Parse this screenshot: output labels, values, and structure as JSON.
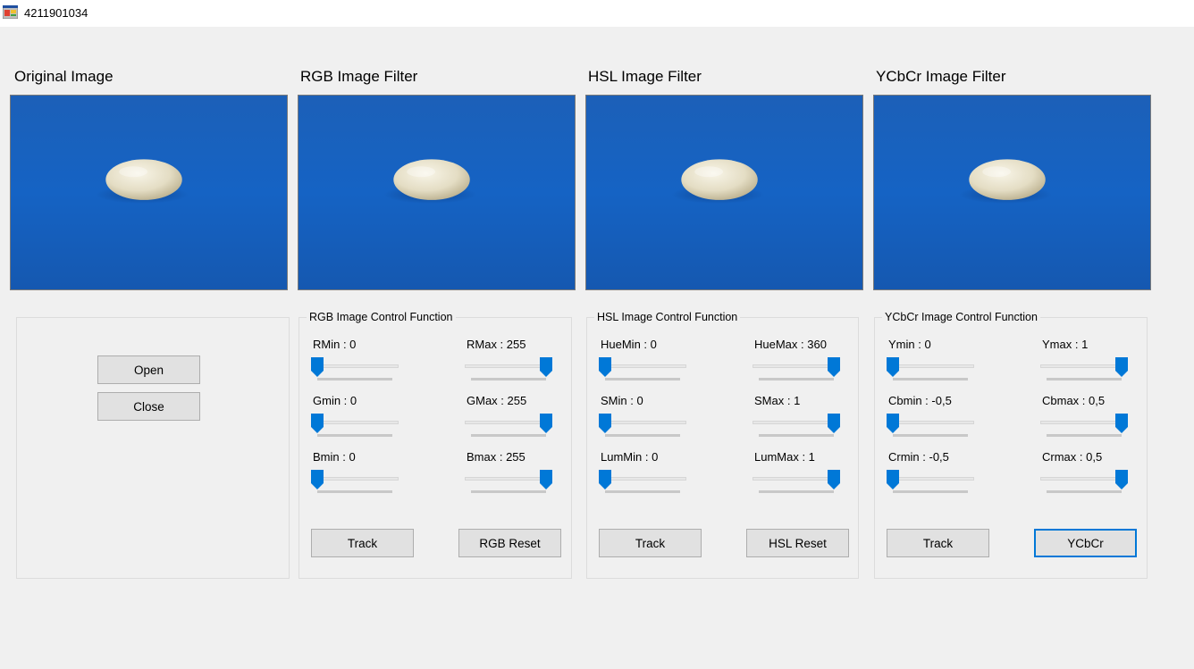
{
  "window": {
    "title": "4211901034"
  },
  "captions": [
    "Original Image",
    "RGB Image Filter",
    "HSL Image Filter",
    "YCbCr Image Filter"
  ],
  "image_icon": "pill-photo",
  "colors": {
    "accent": "#0078d7",
    "image_background": "#1a5fb4",
    "pill": "#e8e2cc"
  },
  "file_panel": {
    "open_label": "Open",
    "close_label": "Close"
  },
  "rgb": {
    "title": "RGB Image Control Function",
    "labels": [
      "RMin : 0",
      "RMax : 255",
      "Gmin : 0",
      "GMax : 255",
      "Bmin : 0",
      "Bmax : 255"
    ],
    "values": [
      0,
      1,
      0,
      1,
      0,
      1
    ],
    "track_label": "Track",
    "reset_label": "RGB Reset"
  },
  "hsl": {
    "title": "HSL Image Control Function",
    "labels": [
      "HueMin : 0",
      "HueMax : 360",
      "SMin : 0",
      "SMax : 1",
      "LumMin : 0",
      "LumMax : 1"
    ],
    "values": [
      0,
      1,
      0,
      1,
      0,
      1
    ],
    "track_label": "Track",
    "reset_label": "HSL Reset"
  },
  "ycbcr": {
    "title": "YCbCr Image Control Function",
    "labels": [
      "Ymin : 0",
      "Ymax : 1",
      "Cbmin : -0,5",
      "Cbmax : 0,5",
      "Crmin : -0,5",
      "Crmax : 0,5"
    ],
    "values": [
      0,
      1,
      0,
      1,
      0,
      1
    ],
    "track_label": "Track",
    "reset_label": "YCbCr"
  }
}
